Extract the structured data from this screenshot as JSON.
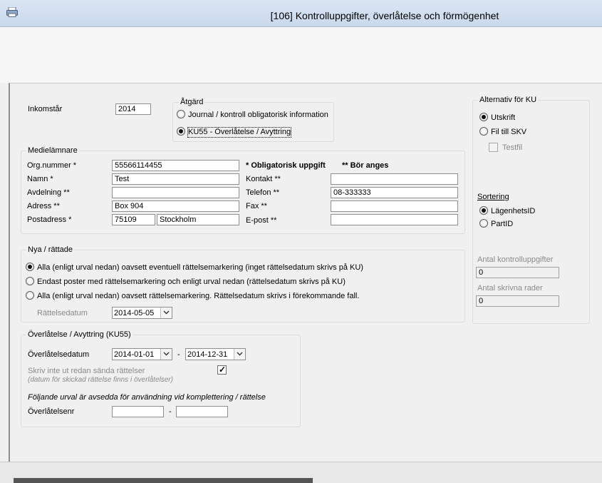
{
  "window": {
    "title": "[106]  Kontrolluppgifter, överlåtelse och förmögenhet"
  },
  "inkomstar": {
    "label": "Inkomstår",
    "value": "2014"
  },
  "atgard": {
    "title": "Åtgärd",
    "options": [
      {
        "label": "Journal / kontroll obligatorisk information",
        "selected": false
      },
      {
        "label": "KU55 - Överlåtelse / Avyttring",
        "selected": true
      }
    ]
  },
  "medielamnare": {
    "title": "Medielämnare",
    "legend_mandatory": "* Obligatorisk uppgift",
    "legend_should": "** Bör anges",
    "fields": {
      "orgnummer": {
        "label": "Org.nummer *",
        "value": "55566114455"
      },
      "namn": {
        "label": "Namn *",
        "value": "Test"
      },
      "avdelning": {
        "label": "Avdelning **",
        "value": ""
      },
      "adress": {
        "label": "Adress **",
        "value": "Box 904"
      },
      "postadress": {
        "label": "Postadress *",
        "postnr": "75109",
        "ort": "Stockholm"
      },
      "kontakt": {
        "label": "Kontakt **",
        "value": ""
      },
      "telefon": {
        "label": "Telefon **",
        "value": "08-333333"
      },
      "fax": {
        "label": "Fax **",
        "value": ""
      },
      "epost": {
        "label": "E-post **",
        "value": ""
      }
    }
  },
  "nya": {
    "title": "Nya / rättade",
    "options": [
      {
        "label": "Alla (enligt urval nedan) oavsett eventuell rättelsemarkering (inget rättelsedatum skrivs på KU)",
        "selected": true
      },
      {
        "label": "Endast poster med rättelsemarkering och enligt urval nedan (rättelsedatum skrivs på KU)",
        "selected": false
      },
      {
        "label": "Alla (enligt urval nedan) oavsett rättelsemarkering. Rättelsedatum skrivs i förekommande fall.",
        "selected": false
      }
    ],
    "rattelsedatum_label": "Rättelsedatum",
    "rattelsedatum_value": "2014-05-05"
  },
  "overlatelse": {
    "title": "Överlåtelse / Avyttring (KU55)",
    "datum_label": "Överlåtelsedatum",
    "datum_from": "2014-01-01",
    "dash": "-",
    "datum_to": "2014-12-31",
    "skriv_inte_label": "Skriv inte ut redan sända rättelser",
    "skriv_inte_sub": "(datum för skickad rättelse finns i överlåtelser)",
    "skriv_inte_checked": true,
    "note": "Följande urval är avsedda för användning vid komplettering / rättelse",
    "nr_label": "Överlåtelsenr",
    "nr_from": "",
    "nr_to": ""
  },
  "alternativ": {
    "title": "Alternativ för KU",
    "options": [
      {
        "label": "Utskrift",
        "selected": true
      },
      {
        "label": "Fil till SKV",
        "selected": false
      }
    ],
    "testfil_label": "Testfil",
    "sortering_label": "Sortering",
    "sort_options": [
      {
        "label": "LägenhetsID",
        "selected": true
      },
      {
        "label": "PartID",
        "selected": false
      }
    ],
    "antal_kontroll_label": "Antal kontrolluppgifter",
    "antal_kontroll_value": "0",
    "antal_rader_label": "Antal skrivna rader",
    "antal_rader_value": "0"
  }
}
